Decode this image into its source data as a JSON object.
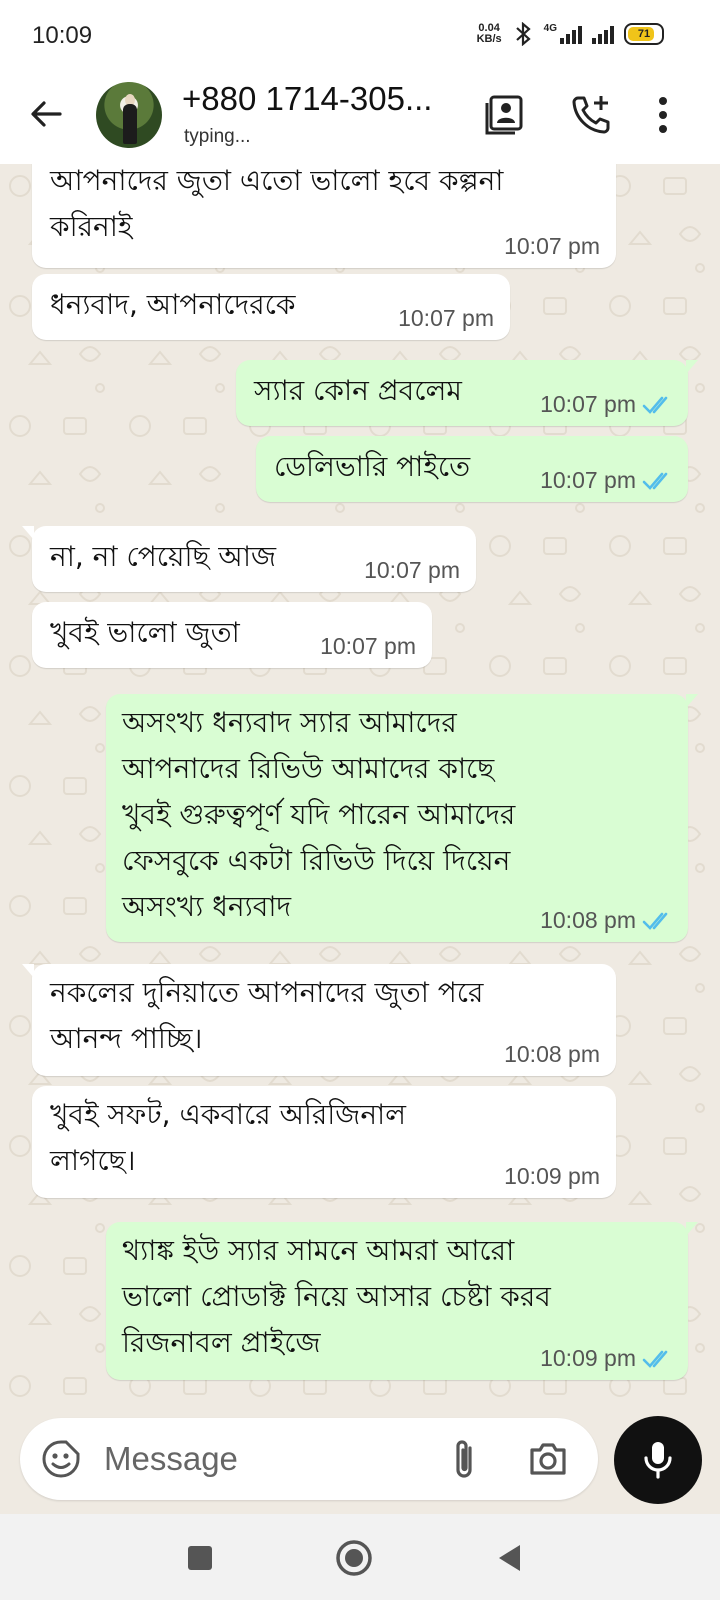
{
  "status_bar": {
    "time": "10:09",
    "net_speed_value": "0.04",
    "net_speed_unit": "KB/s",
    "network_type": "4G",
    "battery": "71",
    "battery_level": 0.71
  },
  "header": {
    "contact_name": "+880 1714-305...",
    "contact_status": "typing..."
  },
  "messages": [
    {
      "direction": "in",
      "lines": [
        "আপনাদের জুতা এতো ভালো হবে কল্পনা",
        "করিনাই"
      ],
      "time": "10:07 pm"
    },
    {
      "direction": "in",
      "lines": [
        "ধন্যবাদ, আপনাদেরকে"
      ],
      "time": "10:07 pm"
    },
    {
      "direction": "out",
      "lines": [
        "স্যার কোন প্রবলেম"
      ],
      "time": "10:07 pm",
      "read": true
    },
    {
      "direction": "out",
      "lines": [
        "ডেলিভারি পাইতে"
      ],
      "time": "10:07 pm",
      "read": true
    },
    {
      "direction": "in",
      "lines": [
        "না, না পেয়েছি আজ"
      ],
      "time": "10:07 pm"
    },
    {
      "direction": "in",
      "lines": [
        "খুবই ভালো জুতা"
      ],
      "time": "10:07 pm"
    },
    {
      "direction": "out",
      "lines": [
        "অসংখ্য ধন্যবাদ স্যার আমাদের",
        "আপনাদের রিভিউ আমাদের কাছে",
        "খুবই গুরুত্বপূর্ণ যদি পারেন আমাদের",
        "ফেসবুকে একটা রিভিউ দিয়ে দিয়েন",
        "অসংখ্য ধন্যবাদ"
      ],
      "time": "10:08 pm",
      "read": true
    },
    {
      "direction": "in",
      "lines": [
        "নকলের দুনিয়াতে আপনাদের জুতা পরে",
        "আনন্দ পাচ্ছি।"
      ],
      "time": "10:08 pm"
    },
    {
      "direction": "in",
      "lines": [
        "খুবই সফট, একবারে অরিজিনাল",
        "লাগছে।"
      ],
      "time": "10:09 pm"
    },
    {
      "direction": "out",
      "lines": [
        "থ্যাঙ্ক ইউ স্যার সামনে আমরা আরো",
        "ভালো প্রোডাক্ট নিয়ে আসার চেষ্টা করব",
        "রিজনাবল প্রাইজে"
      ],
      "time": "10:09 pm",
      "read": true
    }
  ],
  "composer": {
    "placeholder": "Message"
  },
  "colors": {
    "incoming_bubble": "#ffffff",
    "outgoing_bubble": "#d9fdd3",
    "read_ticks": "#53bdeb",
    "chat_background": "#efeae2"
  },
  "icons": [
    "back-arrow-icon",
    "contact-card-icon",
    "add-call-icon",
    "more-options-icon",
    "emoji-icon",
    "attachment-icon",
    "camera-icon",
    "microphone-icon",
    "bluetooth-icon",
    "signal-icon",
    "battery-icon",
    "recent-apps-icon",
    "home-icon",
    "back-nav-icon"
  ]
}
